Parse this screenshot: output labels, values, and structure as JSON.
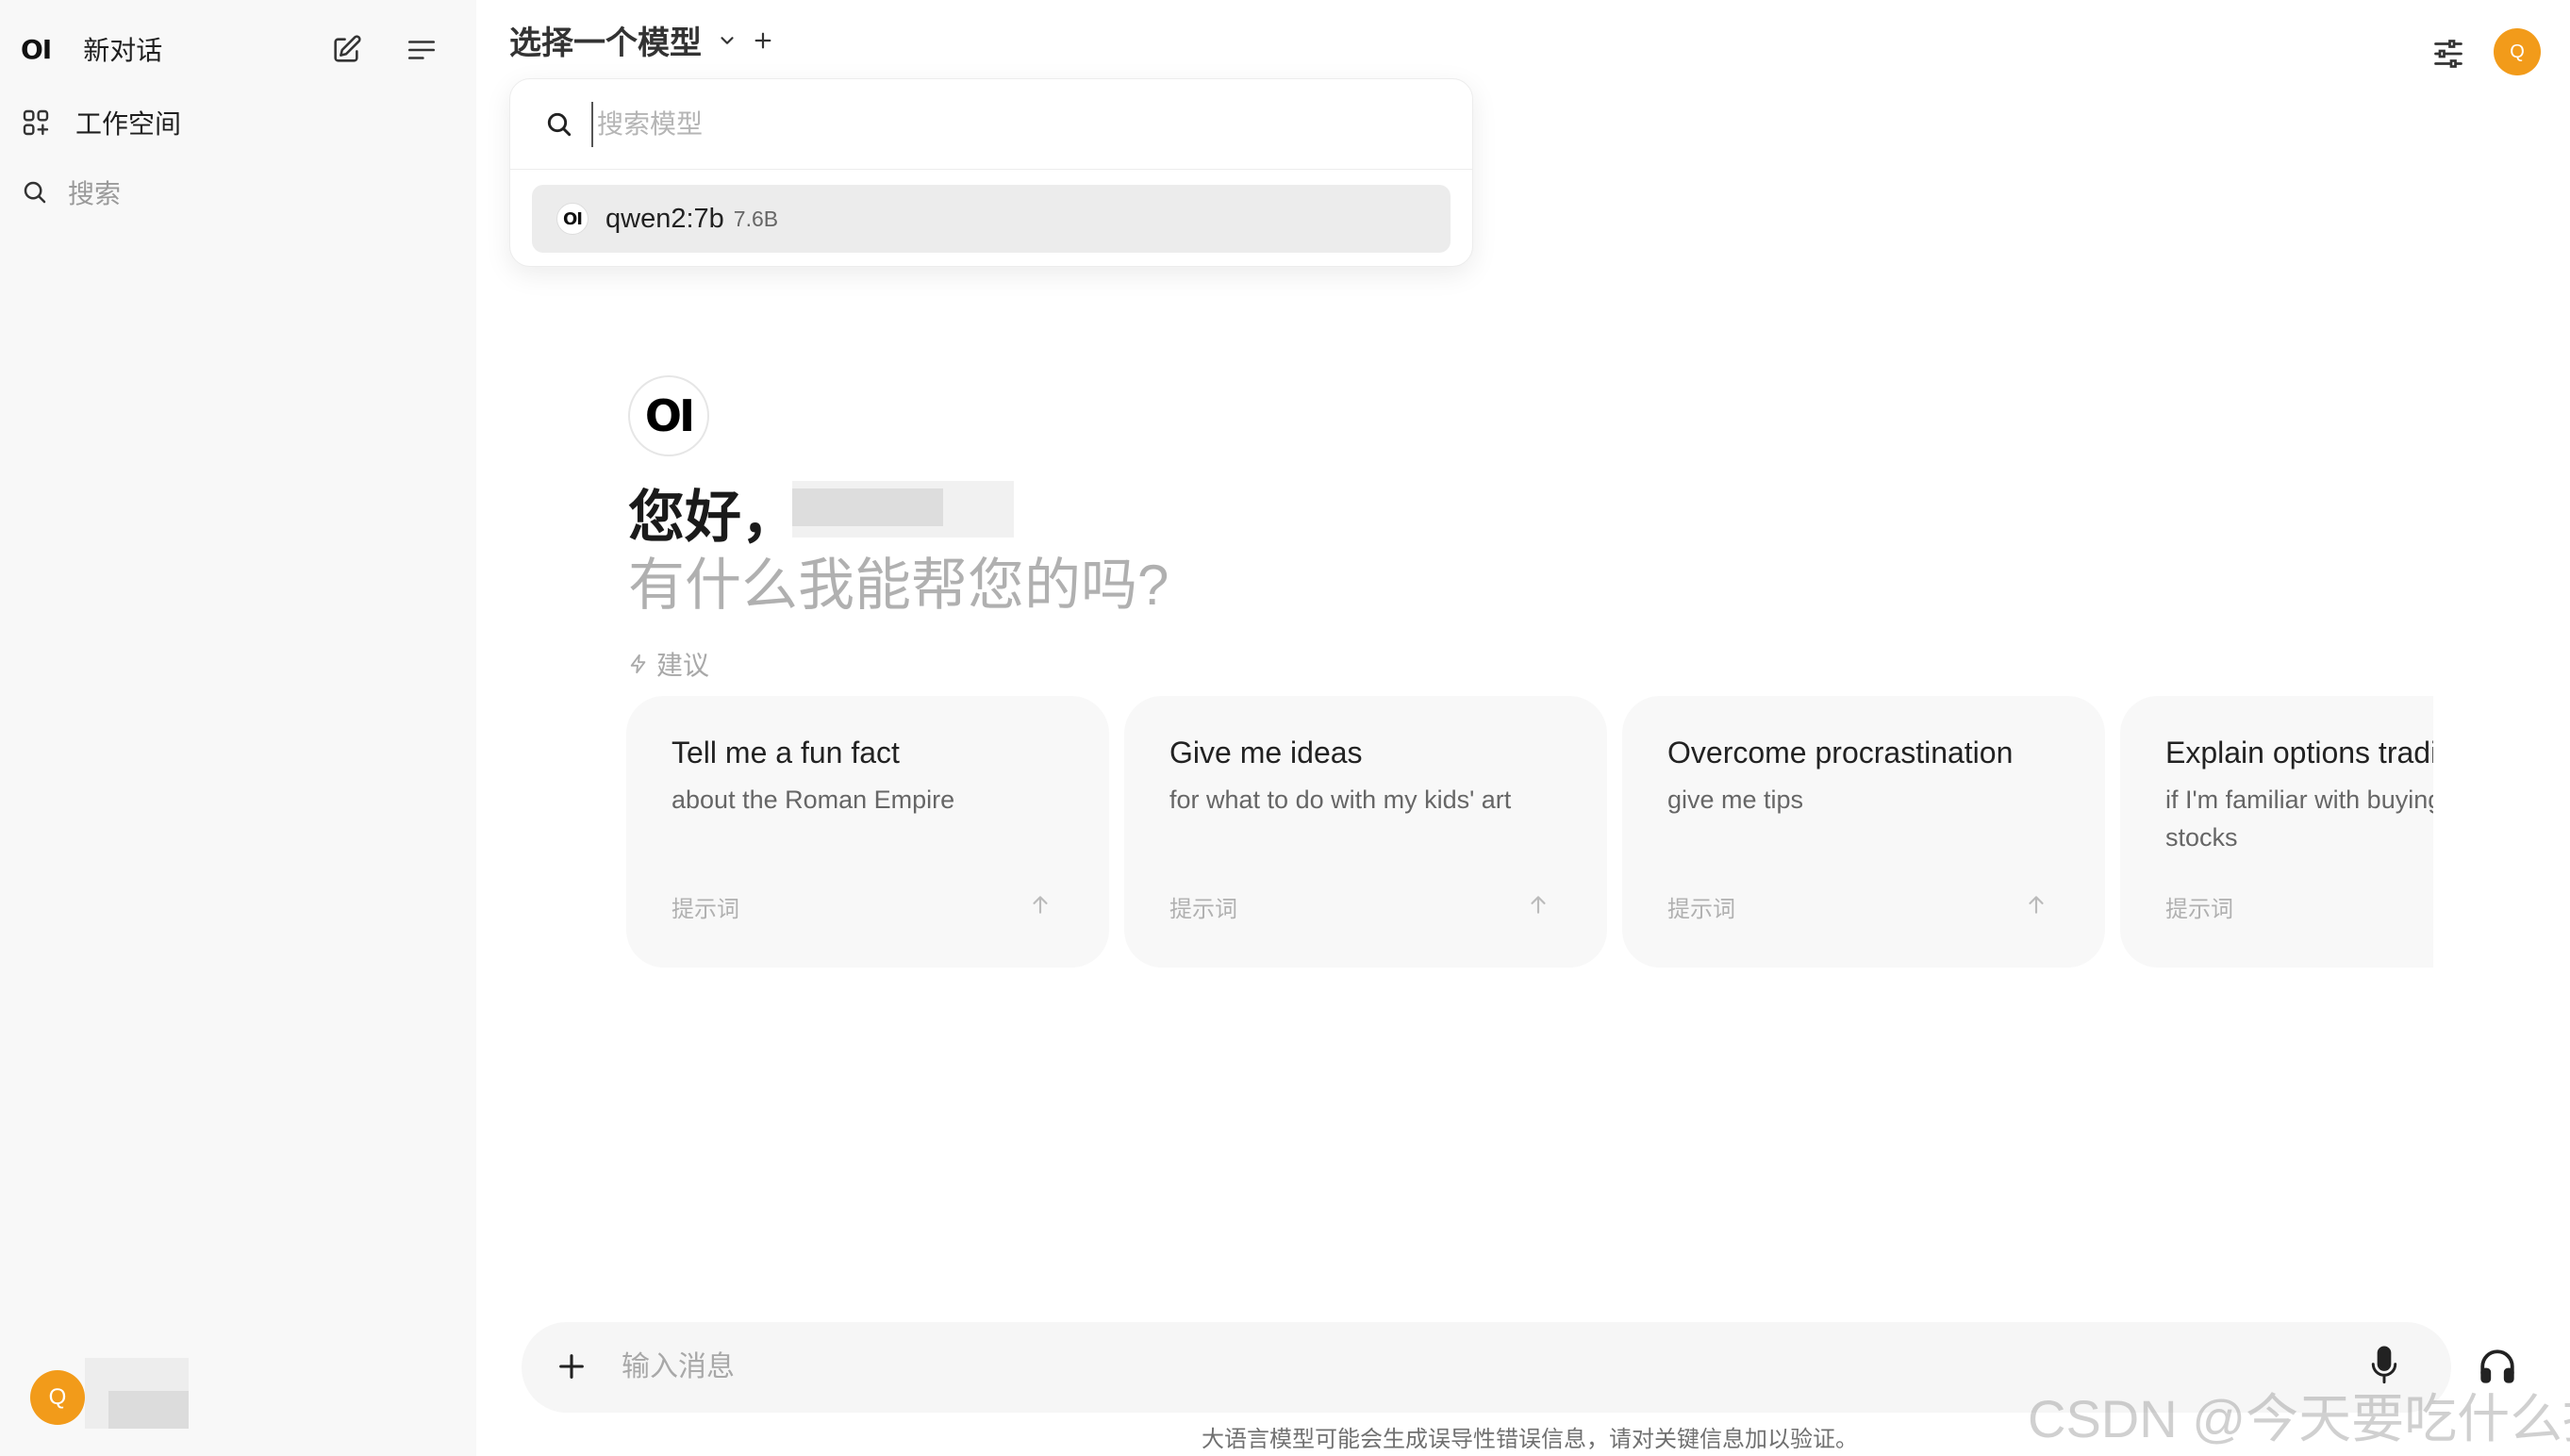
{
  "sidebar": {
    "logo": "OI",
    "new_chat": "新对话",
    "workspace": "工作空间",
    "search": "搜索",
    "user_initial": "Q"
  },
  "header": {
    "model_selector_title": "选择一个模型",
    "user_initial": "Q"
  },
  "model_dropdown": {
    "search_placeholder": "搜索模型",
    "items": [
      {
        "logo": "OI",
        "name": "qwen2:7b",
        "size": "7.6B"
      }
    ]
  },
  "greeting": {
    "logo": "OI",
    "hello": "您好，",
    "subtitle": "有什么我能帮您的吗?"
  },
  "suggestions": {
    "label": "建议",
    "cards": [
      {
        "title": "Tell me a fun fact",
        "subtitle": "about the Roman Empire",
        "footer": "提示词"
      },
      {
        "title": "Give me ideas",
        "subtitle": "for what to do with my kids' art",
        "footer": "提示词"
      },
      {
        "title": "Overcome procrastination",
        "subtitle": "give me tips",
        "footer": "提示词"
      },
      {
        "title": "Explain options trading",
        "subtitle": "if I'm familiar with buying and selling stocks",
        "footer": "提示词"
      }
    ]
  },
  "composer": {
    "placeholder": "输入消息",
    "disclaimer": "大语言模型可能会生成误导性错误信息，请对关键信息加以验证。"
  },
  "watermark": "CSDN @今天要吃什么捏",
  "colors": {
    "accent_avatar": "#f29b1a",
    "sidebar_bg": "#f8f8f8",
    "card_bg": "#f8f8f8"
  }
}
